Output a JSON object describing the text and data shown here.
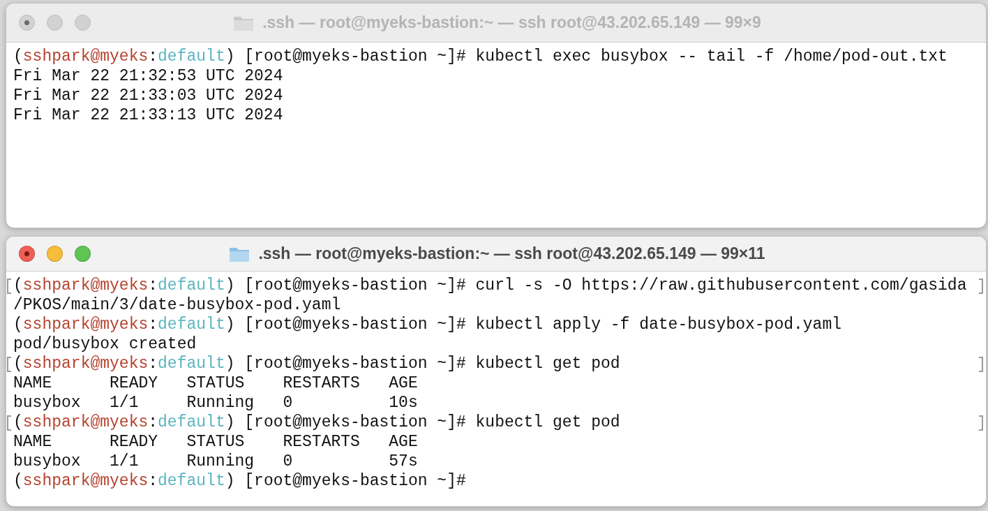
{
  "windows": [
    {
      "title": ".ssh — root@myeks-bastion:~ — ssh root@43.202.65.149 — 99×9",
      "active": false,
      "lines": [
        {
          "marked": false,
          "segments": [
            {
              "kind": "plain",
              "text": "("
            },
            {
              "kind": "user",
              "text": "sshpark@myeks"
            },
            {
              "kind": "plain",
              "text": ":"
            },
            {
              "kind": "context",
              "text": "default"
            },
            {
              "kind": "plain",
              "text": ") [root@myeks-bastion ~]# kubectl exec busybox -- tail -f /home/pod-out.txt"
            }
          ]
        },
        {
          "marked": false,
          "segments": [
            {
              "kind": "plain",
              "text": "Fri Mar 22 21:32:53 UTC 2024"
            }
          ]
        },
        {
          "marked": false,
          "segments": [
            {
              "kind": "plain",
              "text": "Fri Mar 22 21:33:03 UTC 2024"
            }
          ]
        },
        {
          "marked": false,
          "segments": [
            {
              "kind": "plain",
              "text": "Fri Mar 22 21:33:13 UTC 2024"
            }
          ]
        }
      ]
    },
    {
      "title": ".ssh — root@myeks-bastion:~ — ssh root@43.202.65.149 — 99×11",
      "active": true,
      "lines": [
        {
          "marked": true,
          "segments": [
            {
              "kind": "plain",
              "text": "("
            },
            {
              "kind": "user",
              "text": "sshpark@myeks"
            },
            {
              "kind": "plain",
              "text": ":"
            },
            {
              "kind": "context",
              "text": "default"
            },
            {
              "kind": "plain",
              "text": ") [root@myeks-bastion ~]# curl -s -O https://raw.githubusercontent.com/gasida"
            }
          ]
        },
        {
          "marked": false,
          "segments": [
            {
              "kind": "plain",
              "text": "/PKOS/main/3/date-busybox-pod.yaml"
            }
          ]
        },
        {
          "marked": false,
          "segments": [
            {
              "kind": "plain",
              "text": "("
            },
            {
              "kind": "user",
              "text": "sshpark@myeks"
            },
            {
              "kind": "plain",
              "text": ":"
            },
            {
              "kind": "context",
              "text": "default"
            },
            {
              "kind": "plain",
              "text": ") [root@myeks-bastion ~]# kubectl apply -f date-busybox-pod.yaml"
            }
          ]
        },
        {
          "marked": false,
          "segments": [
            {
              "kind": "plain",
              "text": "pod/busybox created"
            }
          ]
        },
        {
          "marked": true,
          "segments": [
            {
              "kind": "plain",
              "text": "("
            },
            {
              "kind": "user",
              "text": "sshpark@myeks"
            },
            {
              "kind": "plain",
              "text": ":"
            },
            {
              "kind": "context",
              "text": "default"
            },
            {
              "kind": "plain",
              "text": ") [root@myeks-bastion ~]# kubectl get pod"
            }
          ]
        },
        {
          "marked": false,
          "segments": [
            {
              "kind": "plain",
              "text": "NAME      READY   STATUS    RESTARTS   AGE"
            }
          ]
        },
        {
          "marked": false,
          "segments": [
            {
              "kind": "plain",
              "text": "busybox   1/1     Running   0          10s"
            }
          ]
        },
        {
          "marked": true,
          "segments": [
            {
              "kind": "plain",
              "text": "("
            },
            {
              "kind": "user",
              "text": "sshpark@myeks"
            },
            {
              "kind": "plain",
              "text": ":"
            },
            {
              "kind": "context",
              "text": "default"
            },
            {
              "kind": "plain",
              "text": ") [root@myeks-bastion ~]# kubectl get pod"
            }
          ]
        },
        {
          "marked": false,
          "segments": [
            {
              "kind": "plain",
              "text": "NAME      READY   STATUS    RESTARTS   AGE"
            }
          ]
        },
        {
          "marked": false,
          "segments": [
            {
              "kind": "plain",
              "text": "busybox   1/1     Running   0          57s"
            }
          ]
        },
        {
          "marked": false,
          "segments": [
            {
              "kind": "plain",
              "text": "("
            },
            {
              "kind": "user",
              "text": "sshpark@myeks"
            },
            {
              "kind": "plain",
              "text": ":"
            },
            {
              "kind": "context",
              "text": "default"
            },
            {
              "kind": "plain",
              "text": ") [root@myeks-bastion ~]#"
            }
          ]
        }
      ]
    }
  ]
}
